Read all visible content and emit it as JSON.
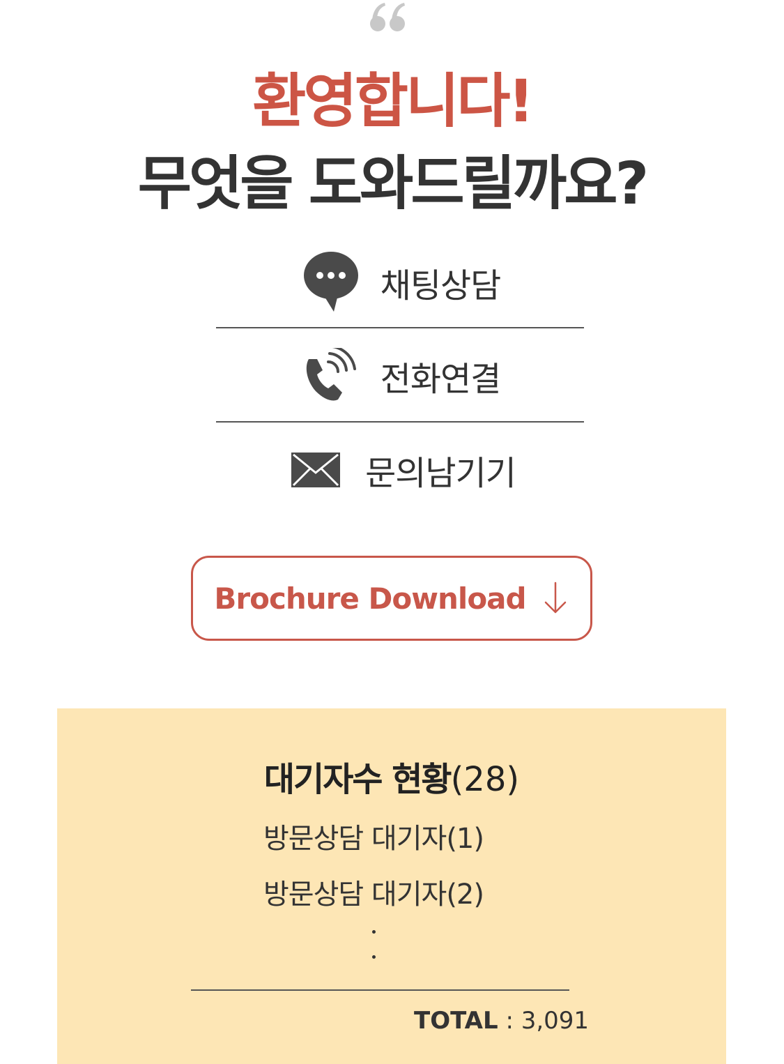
{
  "header": {
    "welcome": "환영합니다!",
    "question": "무엇을 도와드릴까요?"
  },
  "menu": [
    {
      "label": "채팅상담",
      "icon": "chat-bubble-icon"
    },
    {
      "label": "전화연결",
      "icon": "phone-icon"
    },
    {
      "label": "문의남기기",
      "icon": "envelope-icon"
    }
  ],
  "brochure": {
    "label": "Brochure Download",
    "icon": "arrow-down-icon"
  },
  "queue": {
    "title": "대기자수 현황",
    "count": "(28)",
    "items": [
      "방문상담 대기자(1)",
      "방문상담 대기자(2)"
    ],
    "total_key": "TOTAL",
    "total_sep": " : ",
    "total_value": "3,091"
  },
  "colors": {
    "accent": "#cc5545",
    "panel_bg": "#fde6b5",
    "text": "#333333",
    "icon": "#4a4a4a"
  }
}
